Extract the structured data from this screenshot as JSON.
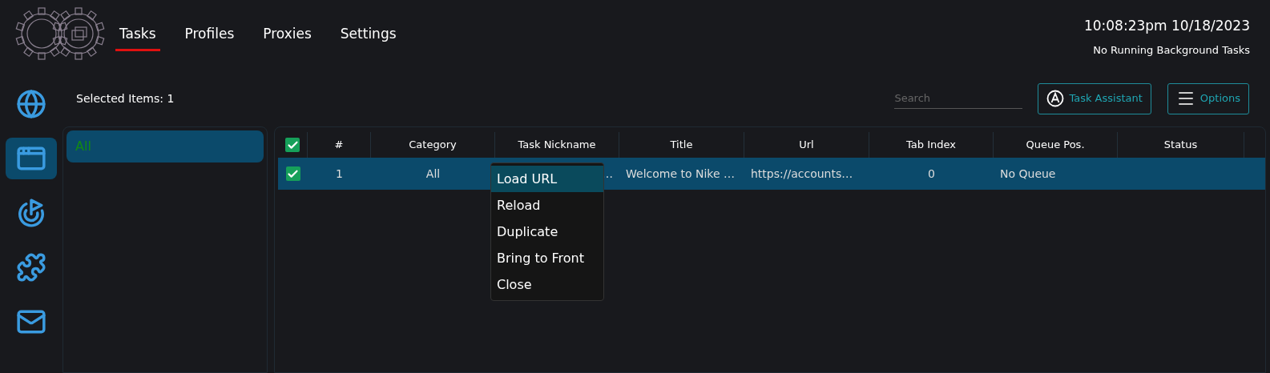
{
  "nav_tabs": [
    {
      "label": "Tasks",
      "selected": true
    },
    {
      "label": "Profiles",
      "selected": false
    },
    {
      "label": "Proxies",
      "selected": false
    },
    {
      "label": "Settings",
      "selected": false
    }
  ],
  "clock": "10:08:23pm 10/18/2023",
  "background_status": "No Running Background Tasks",
  "sidebar": [
    {
      "kind": "globe",
      "selected": false
    },
    {
      "kind": "browser",
      "selected": true
    },
    {
      "kind": "target",
      "selected": false
    },
    {
      "kind": "puzzle",
      "selected": false
    },
    {
      "kind": "mail",
      "selected": false
    }
  ],
  "selected_items": "Selected Items: 1",
  "search": {
    "placeholder": "Search"
  },
  "buttons": [
    {
      "kind": "assistant",
      "label": "Task Assistant"
    },
    {
      "kind": "options",
      "label": "Options"
    }
  ],
  "categories": [
    {
      "label": "All",
      "selected": true
    }
  ],
  "table": {
    "all_checked": true,
    "columns": [
      "#",
      "Category",
      "Task Nickname",
      "Title",
      "Url",
      "Tab Index",
      "Queue Pos.",
      "Status"
    ],
    "rows": [
      {
        "checked": true,
        "selected": true,
        "cells": [
          "1",
          "All",
          "…",
          "Welcome to Nike …",
          "https://accounts…",
          "0",
          "No Queue",
          ""
        ]
      }
    ]
  },
  "context_menu": [
    {
      "label": "Load URL",
      "selected": true
    },
    {
      "label": "Reload",
      "selected": false
    },
    {
      "label": "Duplicate",
      "selected": false
    },
    {
      "label": "Bring to Front",
      "selected": false
    },
    {
      "label": "Close",
      "selected": false
    }
  ]
}
